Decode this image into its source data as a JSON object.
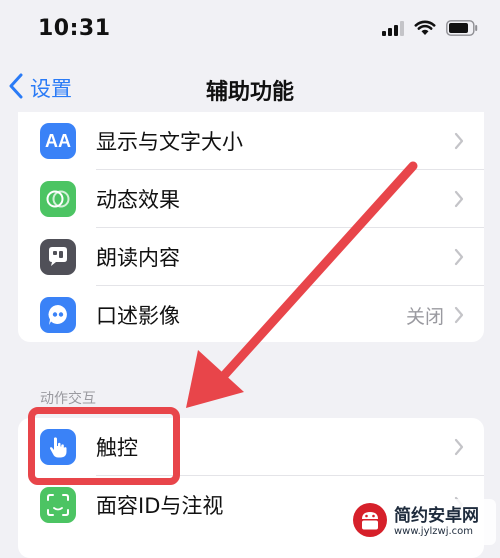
{
  "status_bar": {
    "time": "10:31"
  },
  "nav": {
    "back_label": "设置",
    "title": "辅助功能"
  },
  "vision_group": {
    "items": [
      {
        "label": "显示与文字大小",
        "icon": "text-size-icon",
        "icon_text": "AA",
        "color": "#3a82f7",
        "value": ""
      },
      {
        "label": "动态效果",
        "icon": "motion-icon",
        "color": "#4cc463",
        "value": ""
      },
      {
        "label": "朗读内容",
        "icon": "speech-bubble-icon",
        "color": "#505058",
        "value": ""
      },
      {
        "label": "口述影像",
        "icon": "audio-description-icon",
        "color": "#3a82f7",
        "value": "关闭"
      }
    ]
  },
  "interaction_group": {
    "header": "动作交互",
    "items": [
      {
        "label": "触控",
        "icon": "hand-touch-icon",
        "color": "#3a82f7",
        "value": ""
      },
      {
        "label": "面容ID与注视",
        "icon": "face-id-icon",
        "color": "#4cc463",
        "value": ""
      }
    ]
  },
  "watermark": {
    "title": "简约安卓网",
    "url": "www.jylzwj.com"
  },
  "colors": {
    "accent": "#2a7bf6",
    "annotation": "#e8454a",
    "background": "#f1f1f5"
  }
}
